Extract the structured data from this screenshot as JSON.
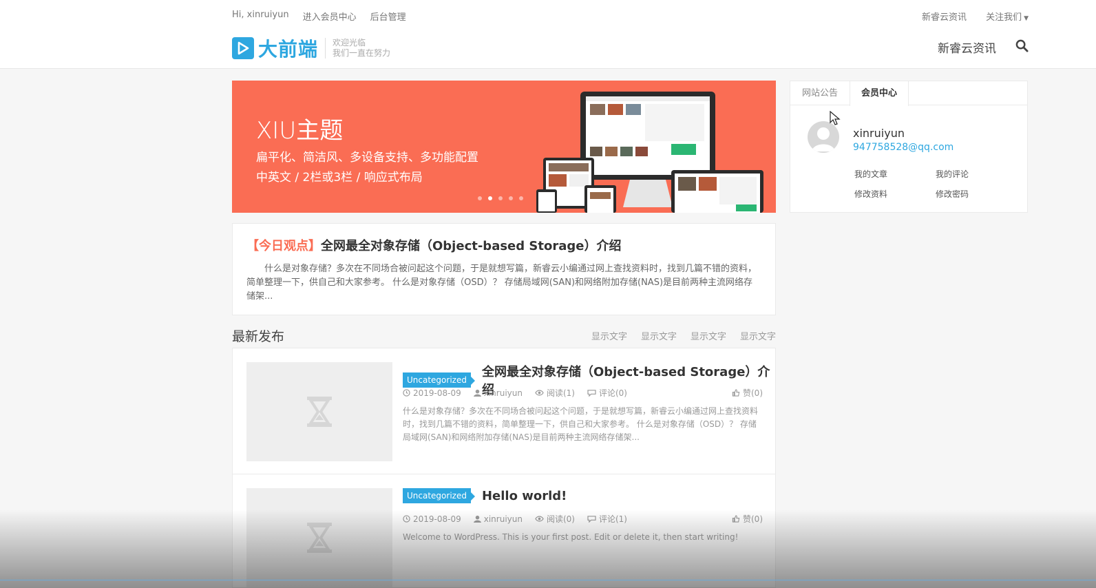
{
  "topbar": {
    "greeting": "Hi, xinruiyun",
    "member_center": "进入会员中心",
    "admin": "后台管理",
    "news": "新睿云资讯",
    "follow": "关注我们"
  },
  "logo": {
    "text": "大前端",
    "slogan_line1": "欢迎光临",
    "slogan_line2": "我们一直在努力"
  },
  "nav": {
    "link": "新睿云资讯",
    "search_icon": "search-icon"
  },
  "banner": {
    "title": "XIU主题",
    "subtitle1": "扁平化、简洁风、多设备支持、多功能配置",
    "subtitle2": "中英文 / 2栏或3栏 / 响应式布局",
    "active_dot": 1,
    "color": "#fa6d54"
  },
  "sidebar": {
    "tabs": [
      "网站公告",
      "会员中心"
    ],
    "active_tab": 1,
    "username": "xinruiyun",
    "email": "947758528@qq.com",
    "links": [
      "我的文章",
      "我的评论",
      "修改资料",
      "修改密码"
    ]
  },
  "feature": {
    "tag": "【今日观点】",
    "title": "全网最全对象存储（Object-based Storage）介绍",
    "excerpt": "什么是对象存储？多次在不同场合被问起这个问题，于是就想写篇，新睿云小编通过网上查找资料时，找到几篇不错的资料，简单整理一下，供自己和大家参考。 什么是对象存储（OSD）？ 存储局域网(SAN)和网络附加存储(NAS)是目前两种主流网络存储架..."
  },
  "section": {
    "title": "最新发布",
    "links": [
      "显示文字",
      "显示文字",
      "显示文字",
      "显示文字"
    ]
  },
  "posts": [
    {
      "category": "Uncategorized",
      "title": "全网最全对象存储（Object-based Storage）介绍",
      "date": "2019-08-09",
      "author": "xinruiyun",
      "views": "阅读(1)",
      "comments": "评论(0)",
      "likes": "赞(0)",
      "excerpt": "什么是对象存储？多次在不同场合被问起这个问题，于是就想写篇，新睿云小编通过网上查找资料时，找到几篇不错的资料，简单整理一下，供自己和大家参考。 什么是对象存储（OSD）？ 存储局域网(SAN)和网络附加存储(NAS)是目前两种主流网络存储架..."
    },
    {
      "category": "Uncategorized",
      "title": "Hello world!",
      "date": "2019-08-09",
      "author": "xinruiyun",
      "views": "阅读(0)",
      "comments": "评论(1)",
      "likes": "赞(0)",
      "excerpt": "Welcome to WordPress. This is your first post. Edit or delete it, then start writing!"
    }
  ],
  "colors": {
    "accent": "#2ea7e0",
    "banner": "#fa6d54"
  }
}
